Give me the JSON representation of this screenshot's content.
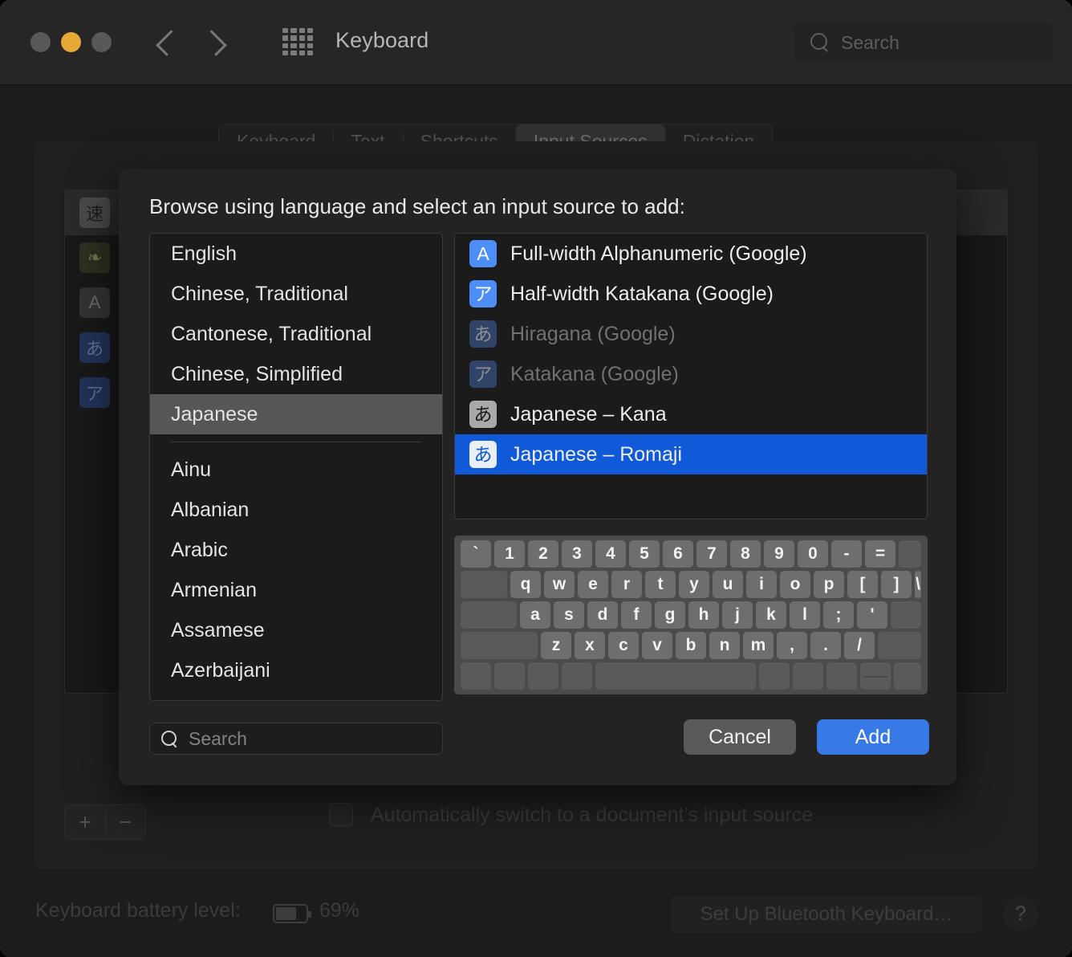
{
  "window": {
    "title": "Keyboard",
    "toolbar_search_placeholder": "Search",
    "traffic_lights": [
      "close",
      "minimize",
      "zoom"
    ],
    "grid_icon": "grid-icon",
    "back_icon": "chevron-left-icon",
    "forward_icon": "chevron-right-icon"
  },
  "tabs": [
    {
      "label": "Keyboard",
      "selected": false
    },
    {
      "label": "Text",
      "selected": false
    },
    {
      "label": "Shortcuts",
      "selected": false
    },
    {
      "label": "Input Sources",
      "selected": true
    },
    {
      "label": "Dictation",
      "selected": false
    }
  ],
  "background": {
    "installed_sources": [
      {
        "glyph": "速",
        "style": "gray",
        "label": "",
        "selected": true
      },
      {
        "glyph": "❧",
        "style": "green",
        "label": "",
        "selected": false
      },
      {
        "glyph": "A",
        "style": "dgray",
        "label": "",
        "selected": false
      },
      {
        "glyph": "あ",
        "style": "dblue",
        "label": "",
        "selected": false
      },
      {
        "glyph": "ア",
        "style": "dblue",
        "label": "",
        "selected": false
      }
    ],
    "add_button": "+",
    "remove_button": "−",
    "auto_switch_label": "Automatically switch to a document’s input source",
    "auto_switch_checked": false
  },
  "footer": {
    "battery_label": "Keyboard battery level:",
    "battery_percent": "69%",
    "battery_level": 69,
    "bluetooth_button": "Set Up Bluetooth Keyboard…",
    "help_button": "?"
  },
  "sheet": {
    "title": "Browse using language and select an input source to add:",
    "search_placeholder": "Search",
    "cancel_label": "Cancel",
    "add_label": "Add",
    "languages_recent": [
      {
        "label": "English",
        "selected": false
      },
      {
        "label": "Chinese, Traditional",
        "selected": false
      },
      {
        "label": "Cantonese, Traditional",
        "selected": false
      },
      {
        "label": "Chinese, Simplified",
        "selected": false
      },
      {
        "label": "Japanese",
        "selected": true
      }
    ],
    "languages_all": [
      {
        "label": "Ainu",
        "selected": false
      },
      {
        "label": "Albanian",
        "selected": false
      },
      {
        "label": "Arabic",
        "selected": false
      },
      {
        "label": "Armenian",
        "selected": false
      },
      {
        "label": "Assamese",
        "selected": false
      },
      {
        "label": "Azerbaijani",
        "selected": false
      }
    ],
    "input_sources": [
      {
        "label": "Full-width Alphanumeric (Google)",
        "glyph": "A",
        "badge": "blue",
        "disabled": false,
        "selected": false
      },
      {
        "label": "Half-width Katakana (Google)",
        "glyph": "ア",
        "badge": "blue",
        "disabled": false,
        "selected": false
      },
      {
        "label": "Hiragana (Google)",
        "glyph": "あ",
        "badge": "blueoff",
        "disabled": true,
        "selected": false
      },
      {
        "label": "Katakana (Google)",
        "glyph": "ア",
        "badge": "blueoff",
        "disabled": true,
        "selected": false
      },
      {
        "label": "Japanese – Kana",
        "glyph": "あ",
        "badge": "lgray",
        "disabled": false,
        "selected": false
      },
      {
        "label": "Japanese – Romaji",
        "glyph": "あ",
        "badge": "white",
        "disabled": false,
        "selected": true
      }
    ],
    "keyboard_preview": {
      "rows": [
        [
          {
            "label": "`",
            "w": ""
          },
          {
            "label": "1",
            "w": ""
          },
          {
            "label": "2",
            "w": ""
          },
          {
            "label": "3",
            "w": ""
          },
          {
            "label": "4",
            "w": ""
          },
          {
            "label": "5",
            "w": ""
          },
          {
            "label": "6",
            "w": ""
          },
          {
            "label": "7",
            "w": ""
          },
          {
            "label": "8",
            "w": ""
          },
          {
            "label": "9",
            "w": ""
          },
          {
            "label": "0",
            "w": ""
          },
          {
            "label": "-",
            "w": ""
          },
          {
            "label": "=",
            "w": ""
          },
          {
            "label": "",
            "w": "flex",
            "blank": true
          }
        ],
        [
          {
            "label": "",
            "w": "w15",
            "blank": true
          },
          {
            "label": "q",
            "w": ""
          },
          {
            "label": "w",
            "w": ""
          },
          {
            "label": "e",
            "w": ""
          },
          {
            "label": "r",
            "w": ""
          },
          {
            "label": "t",
            "w": ""
          },
          {
            "label": "y",
            "w": ""
          },
          {
            "label": "u",
            "w": ""
          },
          {
            "label": "i",
            "w": ""
          },
          {
            "label": "o",
            "w": ""
          },
          {
            "label": "p",
            "w": ""
          },
          {
            "label": "[",
            "w": ""
          },
          {
            "label": "]",
            "w": ""
          },
          {
            "label": "\\",
            "w": "flex"
          }
        ],
        [
          {
            "label": "",
            "w": "w18",
            "blank": true
          },
          {
            "label": "a",
            "w": ""
          },
          {
            "label": "s",
            "w": ""
          },
          {
            "label": "d",
            "w": ""
          },
          {
            "label": "f",
            "w": ""
          },
          {
            "label": "g",
            "w": ""
          },
          {
            "label": "h",
            "w": ""
          },
          {
            "label": "j",
            "w": ""
          },
          {
            "label": "k",
            "w": ""
          },
          {
            "label": "l",
            "w": ""
          },
          {
            "label": ";",
            "w": ""
          },
          {
            "label": "'",
            "w": ""
          },
          {
            "label": "",
            "w": "flex",
            "blank": true
          }
        ],
        [
          {
            "label": "",
            "w": "w25",
            "blank": true
          },
          {
            "label": "z",
            "w": ""
          },
          {
            "label": "x",
            "w": ""
          },
          {
            "label": "c",
            "w": ""
          },
          {
            "label": "v",
            "w": ""
          },
          {
            "label": "b",
            "w": ""
          },
          {
            "label": "n",
            "w": ""
          },
          {
            "label": "m",
            "w": ""
          },
          {
            "label": ",",
            "w": ""
          },
          {
            "label": ".",
            "w": ""
          },
          {
            "label": "/",
            "w": ""
          },
          {
            "label": "",
            "w": "flex",
            "blank": true
          }
        ],
        [
          {
            "label": "",
            "w": "",
            "blank": true
          },
          {
            "label": "",
            "w": "",
            "blank": true
          },
          {
            "label": "",
            "w": "",
            "blank": true
          },
          {
            "label": "",
            "w": "",
            "blank": true
          },
          {
            "label": "",
            "w": "space",
            "blank": true
          },
          {
            "label": "",
            "w": "",
            "blank": true
          },
          {
            "label": "",
            "w": "",
            "blank": true
          },
          {
            "label": "",
            "w": "",
            "blank": true
          },
          {
            "label": "",
            "w": "",
            "blank": true,
            "split": true
          },
          {
            "label": "",
            "w": "flex",
            "blank": true
          }
        ]
      ]
    }
  },
  "colors": {
    "accent_blue": "#1059d8",
    "button_blue": "#3779e6",
    "badge_blue": "#4d8ef7",
    "selection_gray": "#565657",
    "sheet_bg": "#232324",
    "window_bg": "#1c1c1d"
  }
}
